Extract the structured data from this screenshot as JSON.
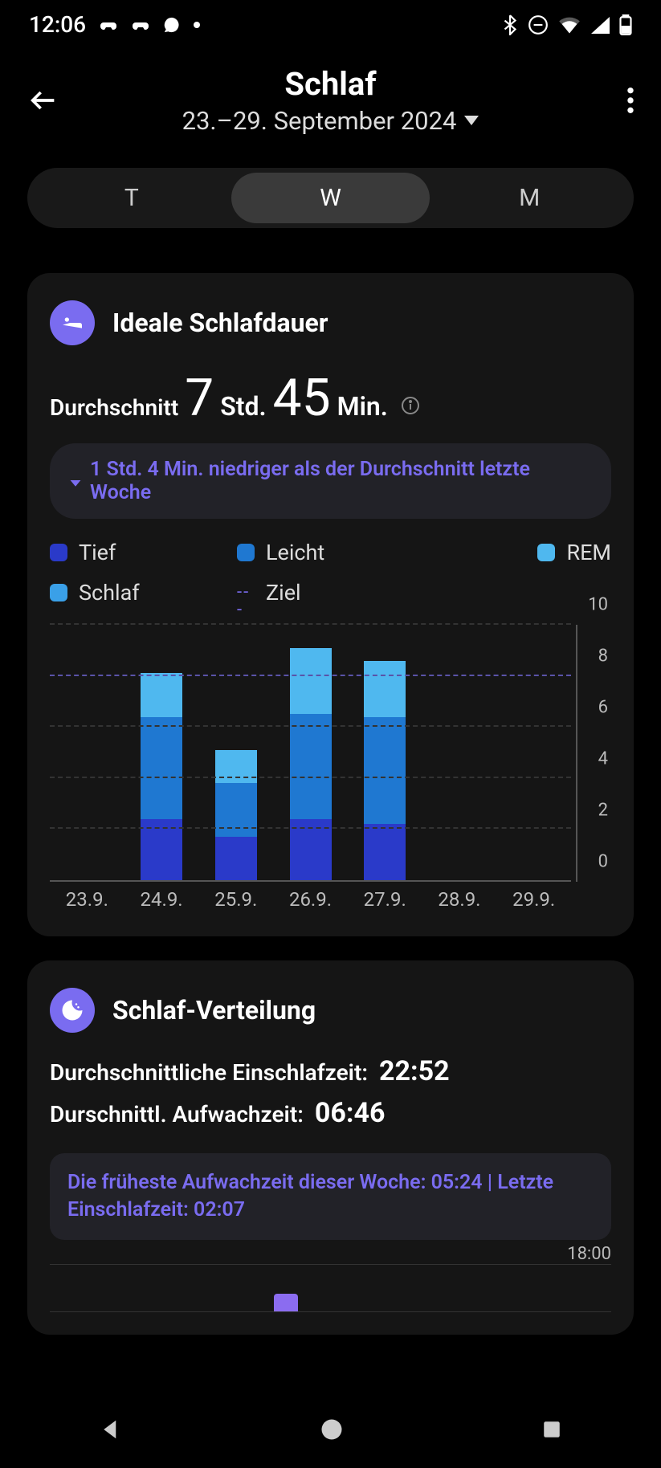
{
  "status": {
    "time": "12:06",
    "icons_left": [
      "controller-icon",
      "controller-icon",
      "chat-icon",
      "dot-icon"
    ],
    "icons_right": [
      "bluetooth-icon",
      "dnd-icon",
      "wifi-icon",
      "signal-icon",
      "battery-icon"
    ]
  },
  "header": {
    "title": "Schlaf",
    "date_range": "23.–29. September 2024"
  },
  "tabs": {
    "day": "T",
    "week": "W",
    "month": "M",
    "active": "W"
  },
  "card1": {
    "title": "Ideale Schlafdauer",
    "avg_label": "Durchschnitt",
    "hours": "7",
    "hours_unit": "Std.",
    "minutes": "45",
    "minutes_unit": "Min.",
    "comparison": "1 Std. 4 Min. niedriger als der Durchschnitt letzte Woche",
    "legend": {
      "deep": "Tief",
      "light": "Leicht",
      "rem": "REM",
      "sleep": "Schlaf",
      "goal": "Ziel"
    },
    "colors": {
      "deep": "#2a3ac9",
      "light": "#1f78d1",
      "rem": "#4fb8ef",
      "sleep": "#3aa0e8",
      "goal": "#7a6cf0"
    }
  },
  "chart_data": {
    "type": "bar",
    "categories": [
      "23.9.",
      "24.9.",
      "25.9.",
      "26.9.",
      "27.9.",
      "28.9.",
      "29.9."
    ],
    "y_ticks": [
      0,
      2,
      4,
      6,
      8,
      10
    ],
    "ylim": [
      0,
      10
    ],
    "goal": 8,
    "series_stack": [
      "deep",
      "light",
      "rem"
    ],
    "series": [
      {
        "name": "deep",
        "color": "#2a3ac9",
        "values": [
          null,
          2.4,
          1.7,
          2.4,
          2.2,
          null,
          null
        ]
      },
      {
        "name": "light",
        "color": "#1f78d1",
        "values": [
          null,
          4.0,
          2.1,
          4.1,
          4.2,
          null,
          null
        ]
      },
      {
        "name": "rem",
        "color": "#4fb8ef",
        "values": [
          null,
          1.7,
          1.3,
          2.6,
          2.2,
          null,
          null
        ]
      }
    ],
    "xlabel": "",
    "ylabel": "",
    "title": ""
  },
  "card2": {
    "title": "Schlaf-Verteilung",
    "row1_label": "Durchschnittliche Einschlafzeit:",
    "row1_value": "22:52",
    "row2_label": "Durschnittl. Aufwachzeit:",
    "row2_value": "06:46",
    "info": "Die früheste Aufwachzeit dieser Woche: 05:24 | Letzte Einschlafzeit: 02:07",
    "dist_right_label": "18:00",
    "dist_marker_pos_pct": 42
  }
}
